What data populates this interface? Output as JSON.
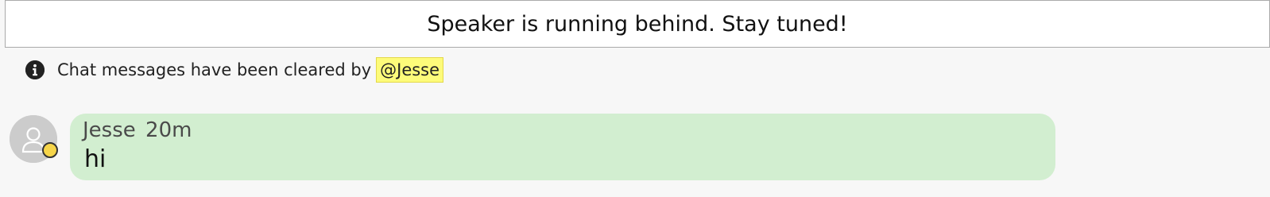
{
  "banner": {
    "text": "Speaker is running behind. Stay tuned!"
  },
  "notice": {
    "icon": "info-icon",
    "text": "Chat messages have been cleared by",
    "mention": "@Jesse",
    "mention_color": "#fdfb7a"
  },
  "messages": [
    {
      "author": "Jesse",
      "time": "20m",
      "text": "hi",
      "bubble_color": "#d2eed0",
      "status_color": "#f6d54a"
    }
  ]
}
